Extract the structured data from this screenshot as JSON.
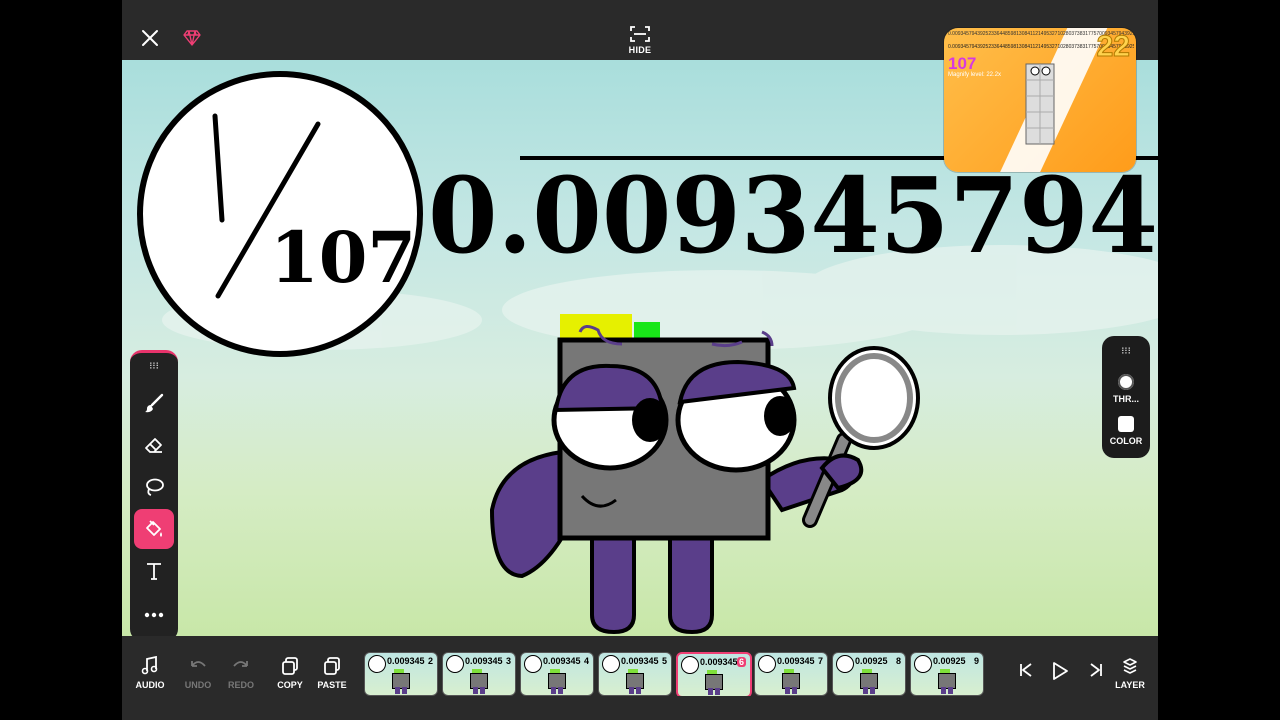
{
  "topbar": {
    "close_icon": "close-icon",
    "gem_icon": "gem-icon",
    "hide_label": "HIDE"
  },
  "canvas": {
    "fraction_numerator": "1",
    "fraction_denominator": "107",
    "decimal_value": "0.009345794",
    "decimal_overflow": "3"
  },
  "preview": {
    "top_digits": "0.00934579439252336448598130841121495327102803738317757009345794392523364485981308411214953271028037383",
    "mid_digits": "0.009345794392523364485981308411214953271028037383177570093457943925233644859813084112149532710280373831775700934579439252",
    "number": "107",
    "magnify_text": "Magnify level: 22.2x",
    "big_number": "22"
  },
  "left_tools": [
    {
      "name": "brush-tool",
      "icon": "brush-icon"
    },
    {
      "name": "eraser-tool",
      "icon": "eraser-icon"
    },
    {
      "name": "lasso-tool",
      "icon": "lasso-icon"
    },
    {
      "name": "fill-tool",
      "icon": "paint-bucket-icon",
      "active": true
    },
    {
      "name": "text-tool",
      "icon": "text-icon"
    },
    {
      "name": "more-tool",
      "icon": "more-icon"
    }
  ],
  "right_tools": {
    "thickness_label": "THR...",
    "color_label": "COLOR"
  },
  "bottombar": {
    "audio_label": "AUDIO",
    "undo_label": "UNDO",
    "redo_label": "REDO",
    "copy_label": "COPY",
    "paste_label": "PASTE",
    "layer_label": "LAYER"
  },
  "frames": [
    {
      "num": "0.009345",
      "index": "2"
    },
    {
      "num": "0.009345",
      "index": "3"
    },
    {
      "num": "0.009345",
      "index": "4"
    },
    {
      "num": "0.009345",
      "index": "5"
    },
    {
      "num": "0.009345",
      "index": "6",
      "selected": true
    },
    {
      "num": "0.009345",
      "index": "7"
    },
    {
      "num": "0.00925",
      "index": "8"
    },
    {
      "num": "0.00925",
      "index": "9"
    }
  ],
  "colors": {
    "accent": "#ef3e74",
    "character_purple": "#5a3e8a",
    "character_gray": "#777777"
  }
}
